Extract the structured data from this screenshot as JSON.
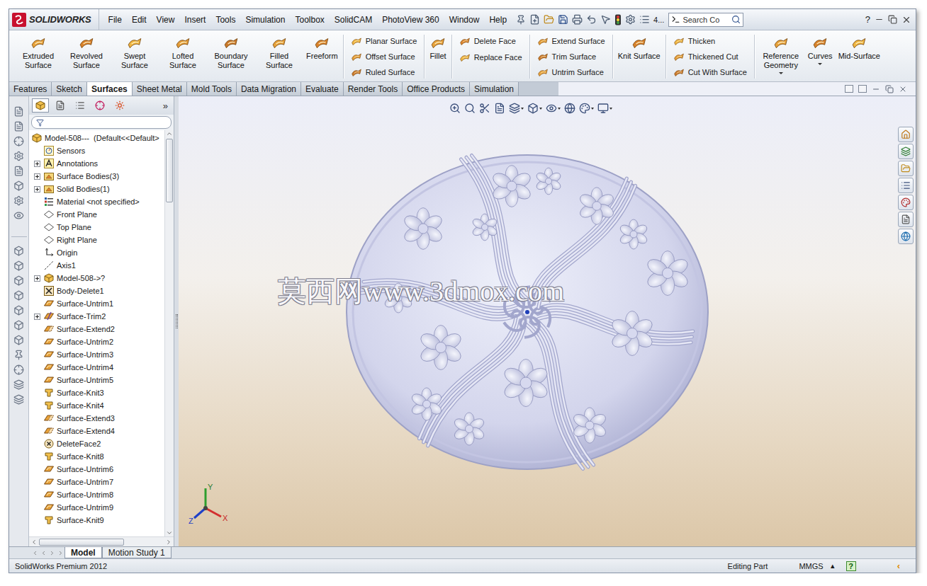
{
  "window": {
    "logo": "SOLIDWORKS",
    "menu": [
      "File",
      "Edit",
      "View",
      "Insert",
      "Tools",
      "Simulation",
      "Toolbox",
      "SolidCAM",
      "PhotoView 360",
      "Window",
      "Help"
    ],
    "search_placeholder": "Search Co",
    "overflow": "4...",
    "help": "?"
  },
  "ribbon": [
    {
      "kind": "large",
      "buttons": [
        {
          "label": "Extruded Surface",
          "dropdown": false
        },
        {
          "label": "Revolved Surface",
          "dropdown": false
        },
        {
          "label": "Swept Surface",
          "dropdown": false
        },
        {
          "label": "Lofted Surface",
          "dropdown": false
        },
        {
          "label": "Boundary Surface",
          "dropdown": false
        },
        {
          "label": "Filled Surface",
          "dropdown": false
        },
        {
          "label": "Freeform",
          "dropdown": false
        }
      ]
    },
    {
      "kind": "column",
      "buttons": [
        {
          "label": "Planar Surface",
          "dropdown": false
        },
        {
          "label": "Offset Surface",
          "dropdown": false
        },
        {
          "label": "Ruled Surface",
          "dropdown": false
        }
      ]
    },
    {
      "kind": "large",
      "buttons": [
        {
          "label": "Fillet",
          "dropdown": false
        }
      ]
    },
    {
      "kind": "column",
      "buttons": [
        {
          "label": "Delete Face",
          "dropdown": false
        },
        {
          "label": "Replace Face",
          "dropdown": false
        }
      ]
    },
    {
      "kind": "column",
      "buttons": [
        {
          "label": "Extend Surface",
          "dropdown": false
        },
        {
          "label": "Trim Surface",
          "dropdown": false
        },
        {
          "label": "Untrim Surface",
          "dropdown": false
        }
      ]
    },
    {
      "kind": "large",
      "buttons": [
        {
          "label": "Knit Surface",
          "dropdown": false
        }
      ]
    },
    {
      "kind": "column",
      "buttons": [
        {
          "label": "Thicken",
          "dropdown": false
        },
        {
          "label": "Thickened Cut",
          "dropdown": false
        },
        {
          "label": "Cut With Surface",
          "dropdown": false
        }
      ]
    },
    {
      "kind": "large",
      "buttons": [
        {
          "label": "Reference Geometry",
          "dropdown": true
        },
        {
          "label": "Curves",
          "dropdown": true
        },
        {
          "label": "Mid-Surface",
          "dropdown": false
        }
      ]
    }
  ],
  "tabs": [
    {
      "label": "Features",
      "selected": false
    },
    {
      "label": "Sketch",
      "selected": false
    },
    {
      "label": "Surfaces",
      "selected": true
    },
    {
      "label": "Sheet Metal",
      "selected": false
    },
    {
      "label": "Mold Tools",
      "selected": false
    },
    {
      "label": "Data Migration",
      "selected": false
    },
    {
      "label": "Evaluate",
      "selected": false
    },
    {
      "label": "Render Tools",
      "selected": false
    },
    {
      "label": "Office Products",
      "selected": false
    },
    {
      "label": "Simulation",
      "selected": false
    }
  ],
  "feature_tree": {
    "more": "»",
    "items": [
      {
        "label": "Model-508---  (Default<<Default>",
        "kind": "part",
        "level": 0,
        "expandable": false,
        "expanded": true
      },
      {
        "label": "Sensors",
        "kind": "sensor",
        "level": 1,
        "expandable": false,
        "expanded": false
      },
      {
        "label": "Annotations",
        "kind": "annotation",
        "level": 1,
        "expandable": true,
        "expanded": false
      },
      {
        "label": "Surface Bodies(3)",
        "kind": "bodies",
        "level": 1,
        "expandable": true,
        "expanded": false
      },
      {
        "label": "Solid Bodies(1)",
        "kind": "bodies",
        "level": 1,
        "expandable": true,
        "expanded": false
      },
      {
        "label": "Material <not specified>",
        "kind": "material",
        "level": 1,
        "expandable": false,
        "expanded": false
      },
      {
        "label": "Front Plane",
        "kind": "plane",
        "level": 1,
        "expandable": false,
        "expanded": false
      },
      {
        "label": "Top Plane",
        "kind": "plane",
        "level": 1,
        "expandable": false,
        "expanded": false
      },
      {
        "label": "Right Plane",
        "kind": "plane",
        "level": 1,
        "expandable": false,
        "expanded": false
      },
      {
        "label": "Origin",
        "kind": "origin",
        "level": 1,
        "expandable": false,
        "expanded": false
      },
      {
        "label": "Axis1",
        "kind": "axis",
        "level": 1,
        "expandable": false,
        "expanded": false
      },
      {
        "label": "Model-508->?",
        "kind": "part",
        "level": 1,
        "expandable": true,
        "expanded": false
      },
      {
        "label": "Body-Delete1",
        "kind": "body-delete",
        "level": 1,
        "expandable": false,
        "expanded": false
      },
      {
        "label": "Surface-Untrim1",
        "kind": "untrim",
        "level": 1,
        "expandable": false,
        "expanded": false
      },
      {
        "label": "Surface-Trim2",
        "kind": "trim",
        "level": 1,
        "expandable": true,
        "expanded": false
      },
      {
        "label": "Surface-Extend2",
        "kind": "extend",
        "level": 1,
        "expandable": false,
        "expanded": false
      },
      {
        "label": "Surface-Untrim2",
        "kind": "untrim",
        "level": 1,
        "expandable": false,
        "expanded": false
      },
      {
        "label": "Surface-Untrim3",
        "kind": "untrim",
        "level": 1,
        "expandable": false,
        "expanded": false
      },
      {
        "label": "Surface-Untrim4",
        "kind": "untrim",
        "level": 1,
        "expandable": false,
        "expanded": false
      },
      {
        "label": "Surface-Untrim5",
        "kind": "untrim",
        "level": 1,
        "expandable": false,
        "expanded": false
      },
      {
        "label": "Surface-Knit3",
        "kind": "knit",
        "level": 1,
        "expandable": false,
        "expanded": false
      },
      {
        "label": "Surface-Knit4",
        "kind": "knit",
        "level": 1,
        "expandable": false,
        "expanded": false
      },
      {
        "label": "Surface-Extend3",
        "kind": "extend",
        "level": 1,
        "expandable": false,
        "expanded": false
      },
      {
        "label": "Surface-Extend4",
        "kind": "extend",
        "level": 1,
        "expandable": false,
        "expanded": false
      },
      {
        "label": "DeleteFace2",
        "kind": "delete-face",
        "level": 1,
        "expandable": false,
        "expanded": false
      },
      {
        "label": "Surface-Knit8",
        "kind": "knit",
        "level": 1,
        "expandable": false,
        "expanded": false
      },
      {
        "label": "Surface-Untrim6",
        "kind": "untrim",
        "level": 1,
        "expandable": false,
        "expanded": false
      },
      {
        "label": "Surface-Untrim7",
        "kind": "untrim",
        "level": 1,
        "expandable": false,
        "expanded": false
      },
      {
        "label": "Surface-Untrim8",
        "kind": "untrim",
        "level": 1,
        "expandable": false,
        "expanded": false
      },
      {
        "label": "Surface-Untrim9",
        "kind": "untrim",
        "level": 1,
        "expandable": false,
        "expanded": false
      },
      {
        "label": "Surface-Knit9",
        "kind": "knit",
        "level": 1,
        "expandable": false,
        "expanded": false
      }
    ]
  },
  "viewport": {
    "watermark": "莫西网www.3dmox.com",
    "triad": {
      "x": "X",
      "y": "Y",
      "z": "Z"
    }
  },
  "bottom_tabs": [
    {
      "label": "Model",
      "selected": true
    },
    {
      "label": "Motion Study 1",
      "selected": false
    }
  ],
  "status_bar": {
    "product": "SolidWorks Premium 2012",
    "mode": "Editing Part",
    "units": "MMGS",
    "units_menu": "▴",
    "help": "?",
    "collapse": "‹"
  }
}
